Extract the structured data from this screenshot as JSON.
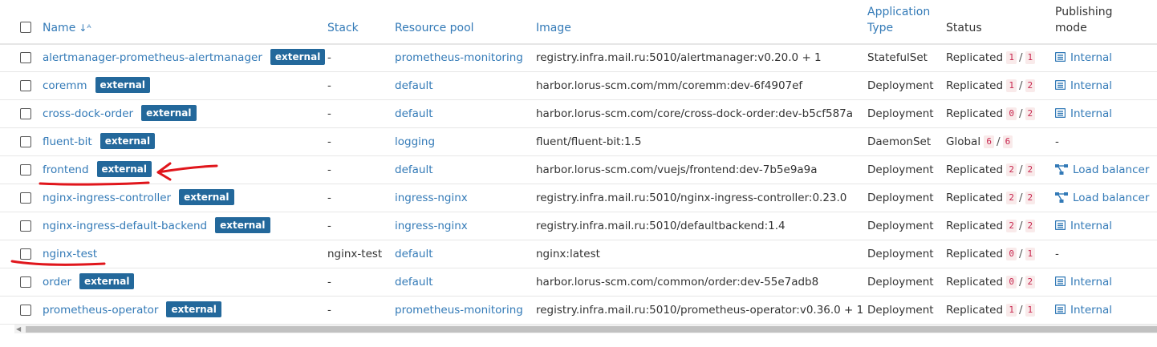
{
  "table": {
    "headers": {
      "name": "Name",
      "stack": "Stack",
      "resource_pool": "Resource pool",
      "image": "Image",
      "application_type_line1": "Application",
      "application_type_line2": "Type",
      "status": "Status",
      "publishing_mode_line1": "Publishing",
      "publishing_mode_line2": "mode"
    },
    "rows": [
      {
        "name": "alertmanager-prometheus-alertmanager",
        "external": "external",
        "stack": "-",
        "pool": "prometheus-monitoring",
        "image": "registry.infra.mail.ru:5010/alertmanager:v0.20.0 + 1",
        "type": "StatefulSet",
        "status": "Replicated",
        "running": "1",
        "total": "1",
        "publishing": "Internal",
        "publishing_icon": "list-icon"
      },
      {
        "name": "coremm",
        "external": "external",
        "stack": "-",
        "pool": "default",
        "image": "harbor.lorus-scm.com/mm/coremm:dev-6f4907ef",
        "type": "Deployment",
        "status": "Replicated",
        "running": "1",
        "total": "2",
        "publishing": "Internal",
        "publishing_icon": "list-icon"
      },
      {
        "name": "cross-dock-order",
        "external": "external",
        "stack": "-",
        "pool": "default",
        "image": "harbor.lorus-scm.com/core/cross-dock-order:dev-b5cf587a",
        "type": "Deployment",
        "status": "Replicated",
        "running": "0",
        "total": "2",
        "publishing": "Internal",
        "publishing_icon": "list-icon"
      },
      {
        "name": "fluent-bit",
        "external": "external",
        "stack": "-",
        "pool": "logging",
        "image": "fluent/fluent-bit:1.5",
        "type": "DaemonSet",
        "status": "Global",
        "running": "6",
        "total": "6",
        "publishing": "-",
        "publishing_icon": ""
      },
      {
        "name": "frontend",
        "external": "external",
        "stack": "-",
        "pool": "default",
        "image": "harbor.lorus-scm.com/vuejs/frontend:dev-7b5e9a9a",
        "type": "Deployment",
        "status": "Replicated",
        "running": "2",
        "total": "2",
        "publishing": "Load balancer",
        "publishing_icon": "load-balancer-icon"
      },
      {
        "name": "nginx-ingress-controller",
        "external": "external",
        "stack": "-",
        "pool": "ingress-nginx",
        "image": "registry.infra.mail.ru:5010/nginx-ingress-controller:0.23.0",
        "type": "Deployment",
        "status": "Replicated",
        "running": "2",
        "total": "2",
        "publishing": "Load balancer",
        "publishing_icon": "load-balancer-icon"
      },
      {
        "name": "nginx-ingress-default-backend",
        "external": "external",
        "stack": "-",
        "pool": "ingress-nginx",
        "image": "registry.infra.mail.ru:5010/defaultbackend:1.4",
        "type": "Deployment",
        "status": "Replicated",
        "running": "2",
        "total": "2",
        "publishing": "Internal",
        "publishing_icon": "list-icon"
      },
      {
        "name": "nginx-test",
        "external": "",
        "stack": "nginx-test",
        "pool": "default",
        "image": "nginx:latest",
        "type": "Deployment",
        "status": "Replicated",
        "running": "0",
        "total": "1",
        "publishing": "-",
        "publishing_icon": ""
      },
      {
        "name": "order",
        "external": "external",
        "stack": "-",
        "pool": "default",
        "image": "harbor.lorus-scm.com/common/order:dev-55e7adb8",
        "type": "Deployment",
        "status": "Replicated",
        "running": "0",
        "total": "2",
        "publishing": "Internal",
        "publishing_icon": "list-icon"
      },
      {
        "name": "prometheus-operator",
        "external": "external",
        "stack": "-",
        "pool": "prometheus-monitoring",
        "image": "registry.infra.mail.ru:5010/prometheus-operator:v0.36.0 + 1",
        "type": "Deployment",
        "status": "Replicated",
        "running": "1",
        "total": "1",
        "publishing": "Internal",
        "publishing_icon": "list-icon"
      }
    ],
    "separator": "/"
  },
  "colors": {
    "link": "#337ab7",
    "badge": "#23689b",
    "count_bg": "#f9eaea",
    "count_text": "#c7254e",
    "annotation": "#e0161c"
  }
}
